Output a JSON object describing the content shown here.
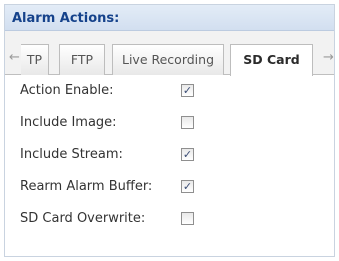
{
  "header": {
    "title": "Alarm Actions:"
  },
  "tabs": [
    {
      "label": "TP",
      "active": false
    },
    {
      "label": "FTP",
      "active": false
    },
    {
      "label": "Live Recording",
      "active": false
    },
    {
      "label": "SD Card",
      "active": true
    }
  ],
  "scroll_icons": {
    "left": "arrow-left-icon",
    "right": "arrow-right-icon"
  },
  "settings": [
    {
      "label": "Action Enable:",
      "checked": true
    },
    {
      "label": "Include Image:",
      "checked": false
    },
    {
      "label": "Include Stream:",
      "checked": true
    },
    {
      "label": "Rearm Alarm Buffer:",
      "checked": true
    },
    {
      "label": "SD Card Overwrite:",
      "checked": false
    }
  ],
  "colors": {
    "header_text": "#15428b",
    "header_bg": "#d9e5f3",
    "check_mark": "#3a4c74"
  }
}
